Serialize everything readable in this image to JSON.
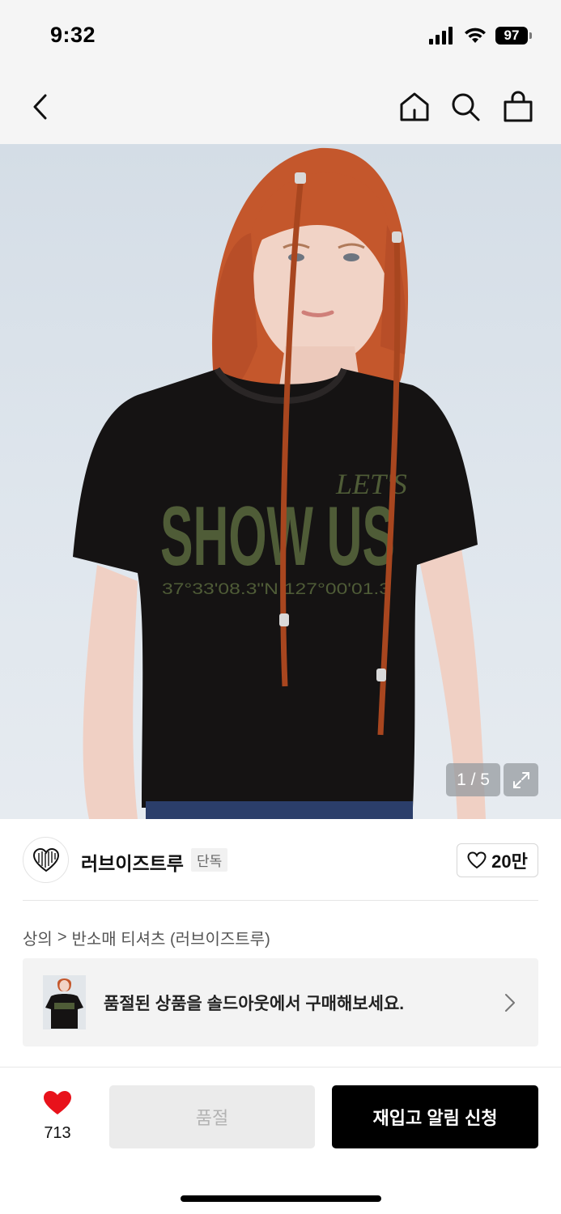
{
  "status_bar": {
    "time": "9:32",
    "battery": "97",
    "signal_icon": "cellular-signal-icon",
    "wifi_icon": "wifi-icon"
  },
  "nav": {
    "back_icon": "back-chevron-icon",
    "home_icon": "home-icon",
    "search_icon": "search-icon",
    "cart_icon": "shopping-bag-icon"
  },
  "product_image": {
    "shirt_print_main": "SHOW US",
    "shirt_print_sub": "LET'S",
    "shirt_print_coords": "37°33'08.3\"N 127°00'01.3",
    "counter": "1 / 5",
    "expand_icon": "expand-icon"
  },
  "brand": {
    "name": "러브이즈트루",
    "badge": "단독",
    "logo_text": "LOVEISTRUE",
    "likes": "20만"
  },
  "breadcrumb": {
    "category": "상의",
    "separator": ">",
    "subcategory": "반소매 티셔츠 (러브이즈트루)"
  },
  "soldout_banner": {
    "text": "품절된 상품을 솔드아웃에서 구매해보세요."
  },
  "bottom_bar": {
    "wish_count": "713",
    "soldout_label": "품절",
    "restock_label": "재입고 알림 신청"
  },
  "colors": {
    "accent_heart": "#e8121b",
    "primary_button": "#000000",
    "disabled_button": "#ebebeb"
  }
}
